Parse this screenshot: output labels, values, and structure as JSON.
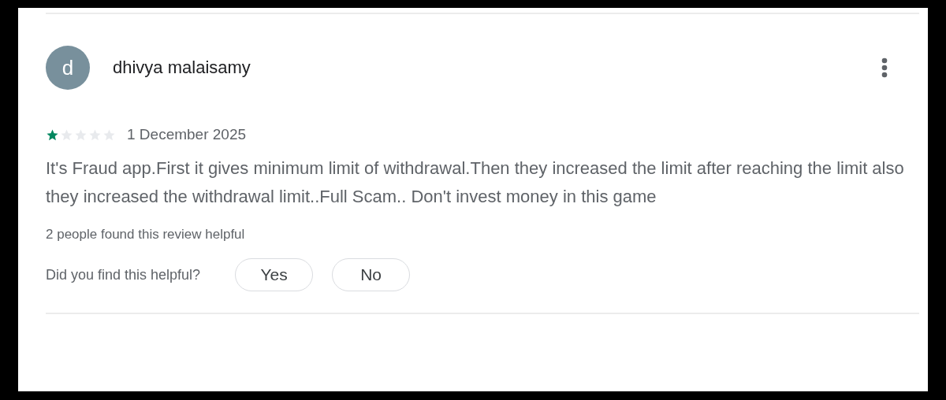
{
  "review": {
    "avatar_letter": "d",
    "author": "dhivya malaisamy",
    "stars": 1,
    "date": "1 December 2025",
    "text": "It's Fraud app.First it gives minimum limit of withdrawal.Then they increased the limit after reaching the limit also they increased the withdrawal limit..Full Scam.. Don't invest money in this game",
    "helpful_count": "2 people found this review helpful",
    "helpful_question": "Did you find this helpful?",
    "buttons": [
      "Yes",
      "No"
    ]
  }
}
